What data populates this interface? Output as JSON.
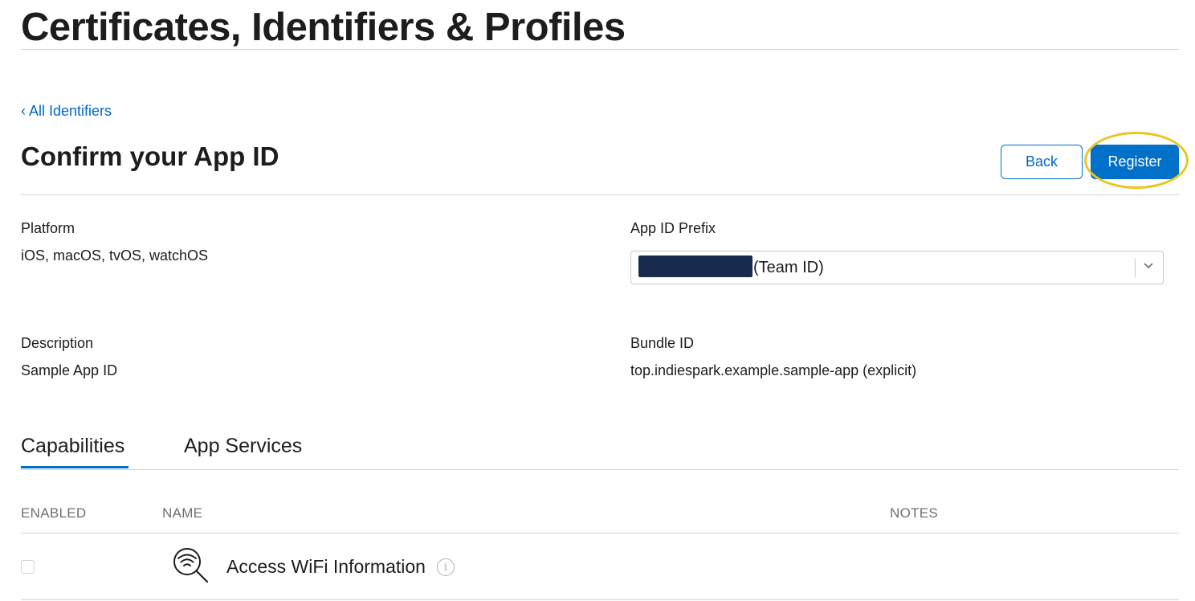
{
  "header": {
    "title": "Certificates, Identifiers & Profiles"
  },
  "nav": {
    "back_link_chevron": "‹",
    "back_link_label": "All Identifiers"
  },
  "section": {
    "title": "Confirm your App ID"
  },
  "actions": {
    "back_label": "Back",
    "register_label": "Register"
  },
  "fields": {
    "platform_label": "Platform",
    "platform_value": "iOS, macOS, tvOS, watchOS",
    "prefix_label": "App ID Prefix",
    "prefix_value": "(Team ID)",
    "description_label": "Description",
    "description_value": "Sample App ID",
    "bundle_label": "Bundle ID",
    "bundle_value": "top.indiespark.example.sample-app (explicit)"
  },
  "tabs": [
    {
      "label": "Capabilities",
      "active": true
    },
    {
      "label": "App Services",
      "active": false
    }
  ],
  "table": {
    "headers": [
      "ENABLED",
      "NAME",
      "NOTES"
    ],
    "rows": [
      {
        "enabled": false,
        "icon": "wifi-search-icon",
        "name": "Access WiFi Information",
        "notes": ""
      }
    ]
  },
  "colors": {
    "accent": "#0070c9",
    "highlight": "#ebc523",
    "redaction": "#182a4e"
  }
}
